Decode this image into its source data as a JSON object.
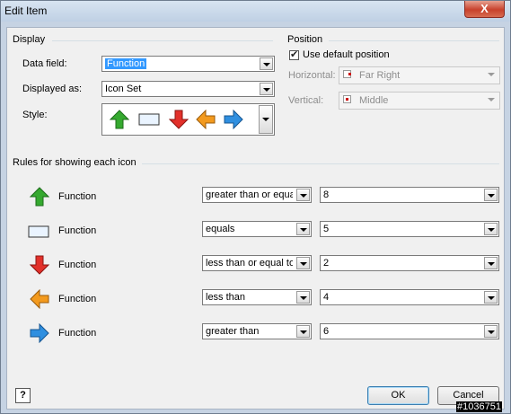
{
  "window": {
    "title": "Edit Item",
    "close_label": "X"
  },
  "display": {
    "section_title": "Display",
    "data_field": {
      "label": "Data field:",
      "value": "Function"
    },
    "displayed_as": {
      "label": "Displayed as:",
      "value": "Icon Set"
    },
    "style": {
      "label": "Style:",
      "icons": [
        "arrow-up-green-icon",
        "rectangle-blank-icon",
        "arrow-down-red-icon",
        "arrow-left-orange-icon",
        "arrow-right-blue-icon"
      ]
    }
  },
  "position": {
    "section_title": "Position",
    "use_default": {
      "label": "Use default position",
      "checked": true
    },
    "horizontal": {
      "label": "Horizontal:",
      "value": "Far Right"
    },
    "vertical": {
      "label": "Vertical:",
      "value": "Middle"
    }
  },
  "rules": {
    "section_title": "Rules for showing each icon",
    "items": [
      {
        "icon": "arrow-up-green-icon",
        "field": "Function",
        "operator": "greater than or equa",
        "value": "8"
      },
      {
        "icon": "rectangle-blank-icon",
        "field": "Function",
        "operator": "equals",
        "value": "5"
      },
      {
        "icon": "arrow-down-red-icon",
        "field": "Function",
        "operator": "less than or equal to",
        "value": "2"
      },
      {
        "icon": "arrow-left-orange-icon",
        "field": "Function",
        "operator": "less than",
        "value": "4"
      },
      {
        "icon": "arrow-right-blue-icon",
        "field": "Function",
        "operator": "greater than",
        "value": "6"
      }
    ]
  },
  "buttons": {
    "help_label": "?",
    "ok_label": "OK",
    "cancel_label": "Cancel"
  },
  "colors": {
    "green": "#35a92f",
    "red": "#e2302a",
    "orange": "#f39a1e",
    "blue": "#2f8fe0",
    "selection": "#3399ff"
  },
  "watermark": "#1036751"
}
